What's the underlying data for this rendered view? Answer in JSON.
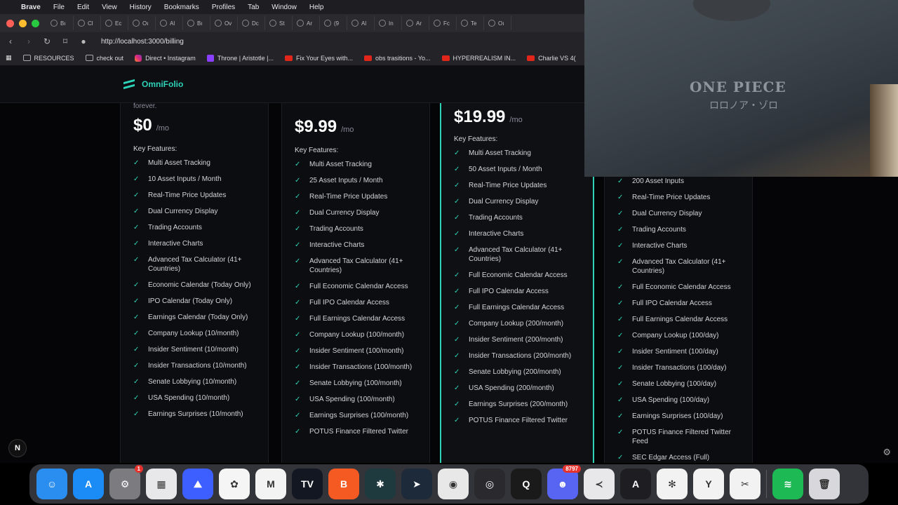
{
  "menubar": {
    "app": "Brave",
    "items": [
      "File",
      "Edit",
      "View",
      "History",
      "Bookmarks",
      "Profiles",
      "Tab",
      "Window",
      "Help"
    ]
  },
  "tabs": [
    "Bı",
    "Cl",
    "Ec",
    "Oı",
    "Al",
    "Bı",
    "Ov",
    "Dc",
    "St",
    "Ar",
    "(9",
    "Al",
    "In",
    "Ar",
    "Fc",
    "Te",
    "Oı"
  ],
  "address": {
    "url": "http://localhost:3000/billing"
  },
  "bookmarks": [
    "RESOURCES",
    "check out",
    "Direct • Instagram",
    "Throne | Aristotle |...",
    "Fix Your Eyes with...",
    "obs trasitions - Yo...",
    "HYPERREALISM IN...",
    "Charlie VS 4("
  ],
  "site": {
    "brand": "OmniFolio"
  },
  "plans": [
    {
      "subtitle": "forever.",
      "price": "$0",
      "per": "/mo",
      "key_features_label": "Key Features:",
      "features": [
        "Multi Asset Tracking",
        "10 Asset Inputs / Month",
        "Real-Time Price Updates",
        "Dual Currency Display",
        "Trading Accounts",
        "Interactive Charts",
        "Advanced Tax Calculator (41+ Countries)",
        "Economic Calendar (Today Only)",
        "IPO Calendar (Today Only)",
        "Earnings Calendar (Today Only)",
        "Company Lookup (10/month)",
        "Insider Sentiment (10/month)",
        "Insider Transactions (10/month)",
        "Senate Lobbying (10/month)",
        "USA Spending (10/month)",
        "Earnings Surprises (10/month)"
      ]
    },
    {
      "price": "$9.99",
      "per": "/mo",
      "key_features_label": "Key Features:",
      "features": [
        "Multi Asset Tracking",
        "25 Asset Inputs / Month",
        "Real-Time Price Updates",
        "Dual Currency Display",
        "Trading Accounts",
        "Interactive Charts",
        "Advanced Tax Calculator (41+ Countries)",
        "Full Economic Calendar Access",
        "Full IPO Calendar Access",
        "Full Earnings Calendar Access",
        "Company Lookup (100/month)",
        "Insider Sentiment (100/month)",
        "Insider Transactions (100/month)",
        "Senate Lobbying (100/month)",
        "USA Spending (100/month)",
        "Earnings Surprises (100/month)",
        "POTUS Finance Filtered Twitter"
      ]
    },
    {
      "price": "$19.99",
      "per": "/mo",
      "key_features_label": "Key Features:",
      "features": [
        "Multi Asset Tracking",
        "50 Asset Inputs / Month",
        "Real-Time Price Updates",
        "Dual Currency Display",
        "Trading Accounts",
        "Interactive Charts",
        "Advanced Tax Calculator (41+ Countries)",
        "Full Economic Calendar Access",
        "Full IPO Calendar Access",
        "Full Earnings Calendar Access",
        "Company Lookup (200/month)",
        "Insider Sentiment (200/month)",
        "Insider Transactions (200/month)",
        "Senate Lobbying (200/month)",
        "USA Spending (200/month)",
        "Earnings Surprises (200/month)",
        "POTUS Finance Filtered Twitter"
      ]
    },
    {
      "features": [
        "200 Asset Inputs",
        "Real-Time Price Updates",
        "Dual Currency Display",
        "Trading Accounts",
        "Interactive Charts",
        "Advanced Tax Calculator (41+ Countries)",
        "Full Economic Calendar Access",
        "Full IPO Calendar Access",
        "Full Earnings Calendar Access",
        "Company Lookup (100/day)",
        "Insider Sentiment (100/day)",
        "Insider Transactions (100/day)",
        "Senate Lobbying (100/day)",
        "USA Spending (100/day)",
        "Earnings Surprises (100/day)",
        "POTUS Finance Filtered Twitter Feed",
        "SEC Edgar Access (Full)"
      ]
    }
  ],
  "webcam": {
    "shirt_text": "ONE PIECE",
    "shirt_sub": "ロロノア・ゾロ"
  },
  "next_badge": "N",
  "dock": {
    "items": [
      {
        "name": "finder",
        "glyph": "☺",
        "color": "#2a8df0"
      },
      {
        "name": "app-store",
        "glyph": "A",
        "color": "#1b8cf5"
      },
      {
        "name": "system-settings",
        "glyph": "⚙",
        "color": "#7c7c80",
        "badge": "1"
      },
      {
        "name": "launchpad",
        "glyph": "▦",
        "color": "#e8e8ea"
      },
      {
        "name": "nordvpn",
        "glyph": "⛰",
        "color": "#3e5fff"
      },
      {
        "name": "photos",
        "glyph": "✿",
        "color": "#f5f5f5"
      },
      {
        "name": "gmail",
        "glyph": "M",
        "color": "#f3f3f3"
      },
      {
        "name": "tradingview",
        "glyph": "TV",
        "color": "#131722"
      },
      {
        "name": "brave",
        "glyph": "B",
        "color": "#f55a22"
      },
      {
        "name": "perplexity",
        "glyph": "✱",
        "color": "#1f3a3f"
      },
      {
        "name": "telegram",
        "glyph": "➤",
        "color": "#1c2a3a"
      },
      {
        "name": "chrome",
        "glyph": "◉",
        "color": "#e8e8e8"
      },
      {
        "name": "obs",
        "glyph": "◎",
        "color": "#2a2a2e"
      },
      {
        "name": "chatgpt-tool",
        "glyph": "Q",
        "color": "#1a1a1a"
      },
      {
        "name": "discord",
        "glyph": "☻",
        "color": "#5865f2",
        "badge": "8797"
      },
      {
        "name": "vscode",
        "glyph": "≺",
        "color": "#e8e8ea"
      },
      {
        "name": "arc",
        "glyph": "A",
        "color": "#1e1e22"
      },
      {
        "name": "chatgpt",
        "glyph": "✻",
        "color": "#f2f2f2"
      },
      {
        "name": "yandex",
        "glyph": "Y",
        "color": "#f2f2f2"
      },
      {
        "name": "capcut",
        "glyph": "✂",
        "color": "#f2f2f2"
      },
      {
        "name": "spotify",
        "glyph": "≋",
        "color": "#1db954"
      },
      {
        "name": "trash",
        "glyph": "🗑",
        "color": "#d8d8dc"
      }
    ]
  }
}
